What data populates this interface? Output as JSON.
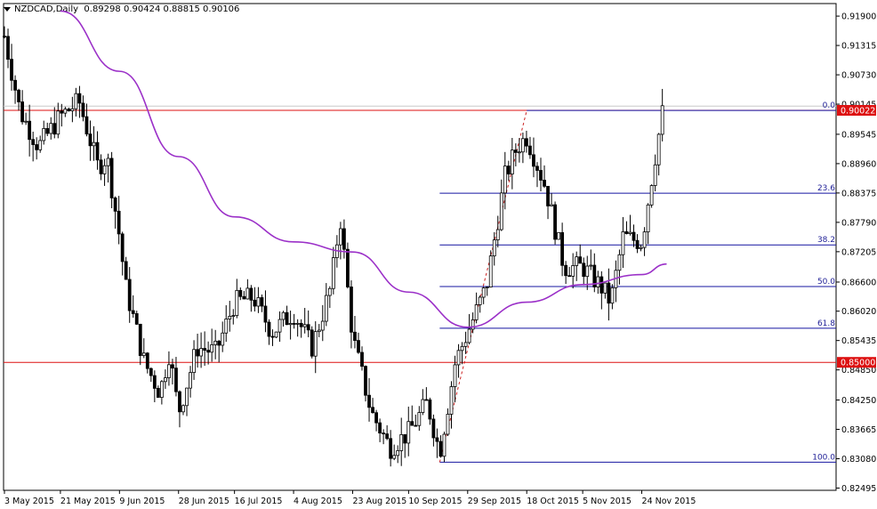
{
  "header": {
    "symbol": "NZDCAD,Daily",
    "open": "0.89298",
    "high": "0.90424",
    "low": "0.88815",
    "close": "0.90106"
  },
  "colors": {
    "background": "#ffffff",
    "grid_frame": "#000000",
    "candle": "#000000",
    "moving_average": "#9b30c8",
    "fib_lines": "#1414a0",
    "fib_labels": "#1e1e96",
    "level_lines": "#dd1111",
    "price_badge_bg": "#dd1111",
    "price_badge_text": "#ffffff",
    "trend_dash": "#cc2222",
    "current_price_line": "#c8c8c8"
  },
  "chart_data": {
    "type": "candlestick",
    "symbol": "NZDCAD",
    "timeframe": "Daily",
    "y_ticks": [
      "0.91900",
      "0.91315",
      "0.90730",
      "0.90145",
      "0.89545",
      "0.88960",
      "0.88375",
      "0.87790",
      "0.87205",
      "0.86600",
      "0.86020",
      "0.85435",
      "0.84850",
      "0.84250",
      "0.83665",
      "0.83080",
      "0.82495"
    ],
    "x_tick_labels": [
      "3 May 2015",
      "21 May 2015",
      "9 Jun 2015",
      "28 Jun 2015",
      "16 Jul 2015",
      "4 Aug 2015",
      "23 Aug 2015",
      "10 Sep 2015",
      "29 Sep 2015",
      "18 Oct 2015",
      "5 Nov 2015",
      "24 Nov 2015"
    ],
    "ylim": [
      0.8245,
      0.9215
    ],
    "price_badges": [
      "0.90022",
      "0.85000"
    ],
    "current_price_tag": "0.90106",
    "horizontal_levels": [
      0.90022,
      0.85
    ],
    "fibonacci": {
      "high": 0.9002,
      "low": 0.8301,
      "levels": [
        {
          "label": "0.0",
          "price": 0.9002
        },
        {
          "label": "23.6",
          "price": 0.8837
        },
        {
          "label": "38.2",
          "price": 0.8734
        },
        {
          "label": "50.0",
          "price": 0.8651
        },
        {
          "label": "61.8",
          "price": 0.8568
        },
        {
          "label": "100.0",
          "price": 0.8301
        }
      ]
    },
    "moving_average": {
      "points": [
        {
          "date": "21 May 2015",
          "value": 0.92
        },
        {
          "date": "9 Jun 2015",
          "value": 0.908
        },
        {
          "date": "28 Jun 2015",
          "value": 0.891
        },
        {
          "date": "16 Jul 2015",
          "value": 0.879
        },
        {
          "date": "4 Aug 2015",
          "value": 0.874
        },
        {
          "date": "23 Aug 2015",
          "value": 0.872
        },
        {
          "date": "10 Sep 2015",
          "value": 0.864
        },
        {
          "date": "29 Sep 2015",
          "value": 0.857
        },
        {
          "date": "18 Oct 2015",
          "value": 0.862
        },
        {
          "date": "5 Nov 2015",
          "value": 0.8655
        },
        {
          "date": "24 Nov 2015",
          "value": 0.8675
        },
        {
          "date": "2 Dec 2015",
          "value": 0.8696
        }
      ]
    },
    "price_path": [
      {
        "date": "3 May 2015",
        "price": 0.915
      },
      {
        "date": "8 May 2015",
        "price": 0.9
      },
      {
        "date": "14 May 2015",
        "price": 0.893
      },
      {
        "date": "21 May 2015",
        "price": 0.899
      },
      {
        "date": "27 May 2015",
        "price": 0.902
      },
      {
        "date": "2 Jun 2015",
        "price": 0.889
      },
      {
        "date": "5 Jun 2015",
        "price": 0.891
      },
      {
        "date": "9 Jun 2015",
        "price": 0.875
      },
      {
        "date": "11 Jun 2015",
        "price": 0.865
      },
      {
        "date": "17 Jun 2015",
        "price": 0.85
      },
      {
        "date": "22 Jun 2015",
        "price": 0.844
      },
      {
        "date": "25 Jun 2015",
        "price": 0.852
      },
      {
        "date": "28 Jun 2015",
        "price": 0.84
      },
      {
        "date": "4 Jul 2015",
        "price": 0.853
      },
      {
        "date": "10 Jul 2015",
        "price": 0.852
      },
      {
        "date": "16 Jul 2015",
        "price": 0.862
      },
      {
        "date": "22 Jul 2015",
        "price": 0.863
      },
      {
        "date": "28 Jul 2015",
        "price": 0.856
      },
      {
        "date": "4 Aug 2015",
        "price": 0.86
      },
      {
        "date": "10 Aug 2015",
        "price": 0.853
      },
      {
        "date": "16 Aug 2015",
        "price": 0.865
      },
      {
        "date": "19 Aug 2015",
        "price": 0.879
      },
      {
        "date": "23 Aug 2015",
        "price": 0.855
      },
      {
        "date": "29 Aug 2015",
        "price": 0.84
      },
      {
        "date": "4 Sep 2015",
        "price": 0.833
      },
      {
        "date": "10 Sep 2015",
        "price": 0.836
      },
      {
        "date": "16 Sep 2015",
        "price": 0.842
      },
      {
        "date": "20 Sep 2015",
        "price": 0.832
      },
      {
        "date": "25 Sep 2015",
        "price": 0.85
      },
      {
        "date": "29 Sep 2015",
        "price": 0.856
      },
      {
        "date": "5 Oct 2015",
        "price": 0.865
      },
      {
        "date": "11 Oct 2015",
        "price": 0.887
      },
      {
        "date": "15 Oct 2015",
        "price": 0.893
      },
      {
        "date": "18 Oct 2015",
        "price": 0.895
      },
      {
        "date": "24 Oct 2015",
        "price": 0.885
      },
      {
        "date": "30 Oct 2015",
        "price": 0.869
      },
      {
        "date": "5 Nov 2015",
        "price": 0.869
      },
      {
        "date": "11 Nov 2015",
        "price": 0.865
      },
      {
        "date": "14 Nov 2015",
        "price": 0.862
      },
      {
        "date": "18 Nov 2015",
        "price": 0.875
      },
      {
        "date": "24 Nov 2015",
        "price": 0.874
      },
      {
        "date": "28 Nov 2015",
        "price": 0.89
      },
      {
        "date": "1 Dec 2015",
        "price": 0.901
      }
    ]
  }
}
